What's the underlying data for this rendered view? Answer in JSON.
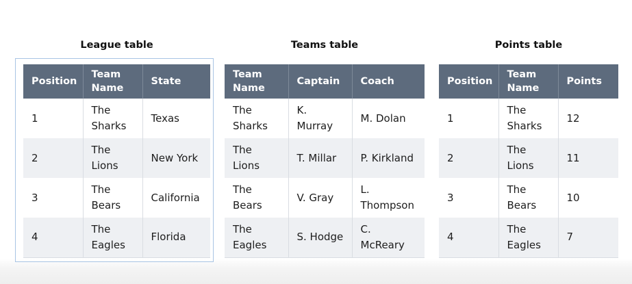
{
  "tables": [
    {
      "title": "League table",
      "columns": [
        "Position",
        "Team Name",
        "State"
      ],
      "rows": [
        [
          "1",
          "The Sharks",
          "Texas"
        ],
        [
          "2",
          "The Lions",
          "New York"
        ],
        [
          "3",
          "The Bears",
          "California"
        ],
        [
          "4",
          "The Eagles",
          "Florida"
        ]
      ]
    },
    {
      "title": "Teams table",
      "columns": [
        "Team Name",
        "Captain",
        "Coach"
      ],
      "rows": [
        [
          "The Sharks",
          "K. Murray",
          "M. Dolan"
        ],
        [
          "The Lions",
          "T. Millar",
          "P. Kirkland"
        ],
        [
          "The Bears",
          "V. Gray",
          "L. Thompson"
        ],
        [
          "The Eagles",
          "S. Hodge",
          "C. McReary"
        ]
      ]
    },
    {
      "title": "Points table",
      "columns": [
        "Position",
        "Team Name",
        "Points"
      ],
      "rows": [
        [
          "1",
          "The Sharks",
          "12"
        ],
        [
          "2",
          "The Lions",
          "11"
        ],
        [
          "3",
          "The Bears",
          "10"
        ],
        [
          "4",
          "The Eagles",
          "7"
        ]
      ]
    }
  ],
  "colors": {
    "header_bg": "#5d6b7d",
    "header_text": "#ffffff",
    "row_alt_bg": "#eef0f3",
    "selection_border": "#a8c4e4"
  }
}
